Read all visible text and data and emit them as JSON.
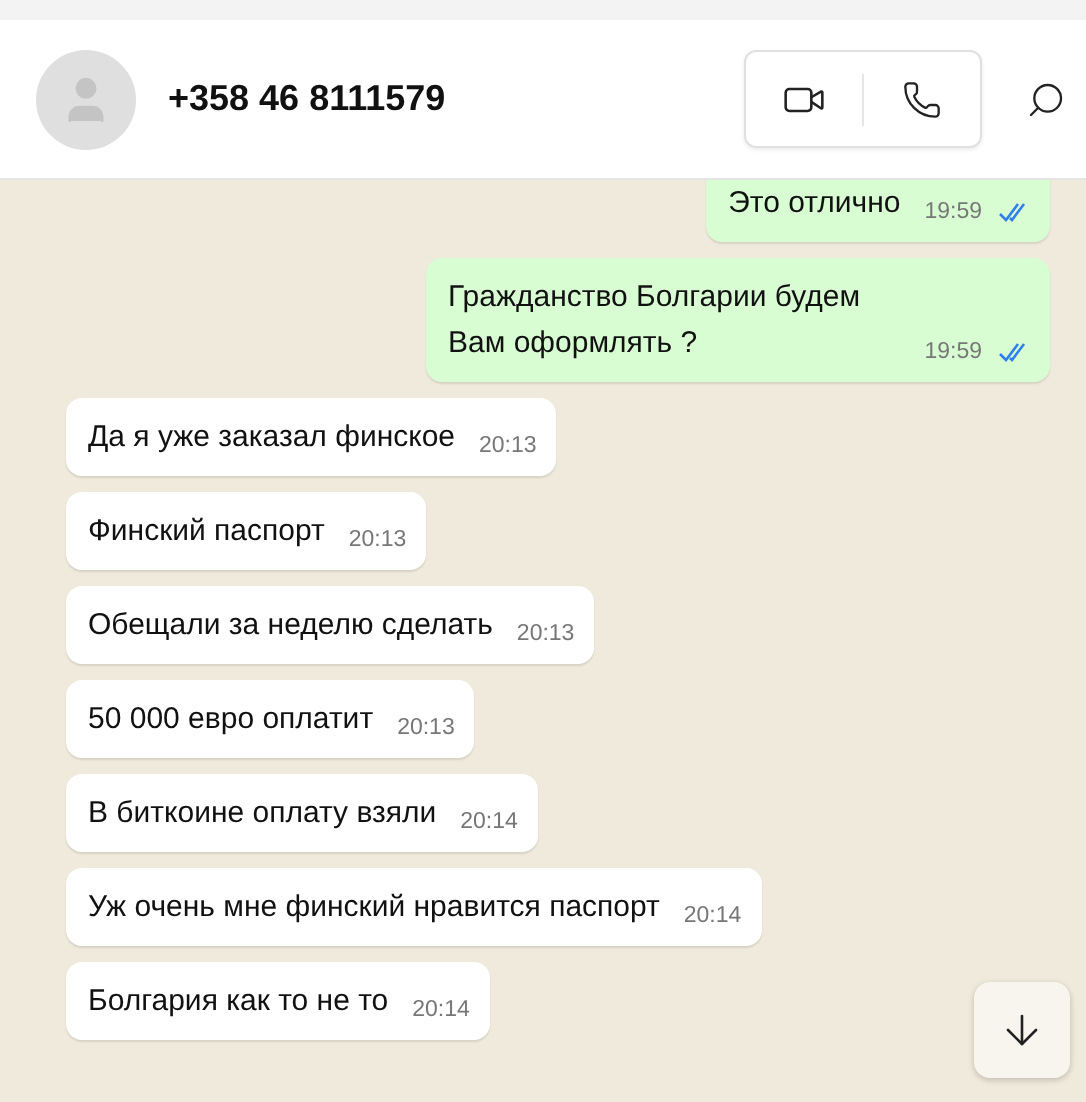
{
  "header": {
    "contact_name": "+358 46 8111579"
  },
  "messages": [
    {
      "kind": "outgoing",
      "text": "Это отлично",
      "time": "19:59",
      "read": true
    },
    {
      "kind": "outgoing",
      "text": "Гражданство Болгарии будем Вам оформлять ?",
      "time": "19:59",
      "read": true
    },
    {
      "kind": "incoming",
      "text": "Да я уже заказал финское",
      "time": "20:13"
    },
    {
      "kind": "incoming",
      "text": "Финский паспорт",
      "time": "20:13"
    },
    {
      "kind": "incoming",
      "text": "Обещали за неделю сделать",
      "time": "20:13"
    },
    {
      "kind": "incoming",
      "text": "50 000 евро оплатит",
      "time": "20:13"
    },
    {
      "kind": "incoming",
      "text": "В биткоине оплату взяли",
      "time": "20:14"
    },
    {
      "kind": "incoming",
      "text": "Уж очень мне финский нравится паспорт",
      "time": "20:14"
    },
    {
      "kind": "incoming",
      "text": "Болгария как то не то",
      "time": "20:14"
    }
  ]
}
